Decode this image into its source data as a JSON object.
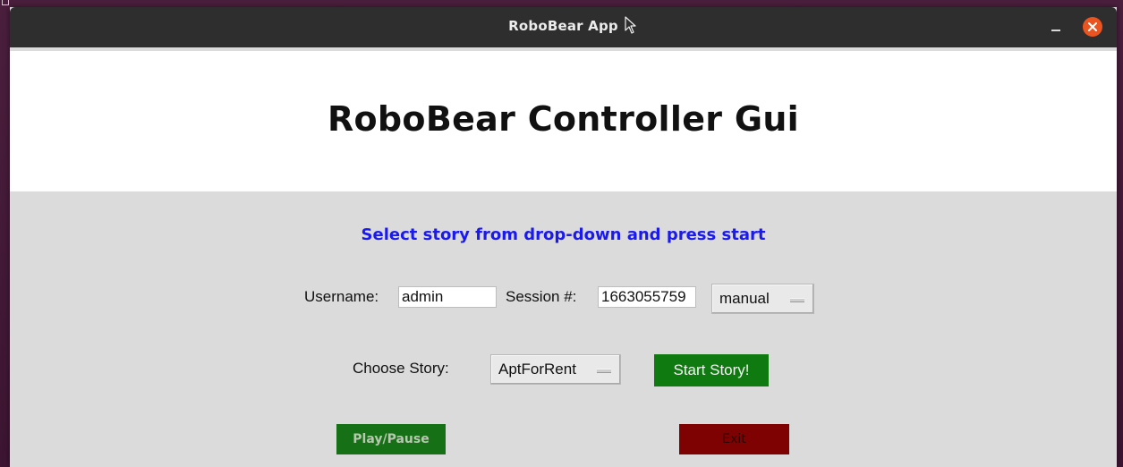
{
  "window": {
    "title": "RoboBear App",
    "close_color": "#e95420",
    "titlebar_color": "#2e2e2e"
  },
  "header": {
    "title": "RoboBear Controller Gui"
  },
  "instruction": {
    "text": "Select story from drop-down and press start",
    "color": "#1a1aee"
  },
  "form": {
    "username_label": "Username:",
    "username_value": "admin",
    "session_label": "Session #:",
    "session_value": "1663055759",
    "mode_selected": "manual",
    "story_label": "Choose Story:",
    "story_selected": "AptForRent",
    "start_label": "Start Story!"
  },
  "controls": {
    "play_pause_label": "Play/Pause",
    "exit_label": "Exit",
    "play_color": "#167016",
    "exit_color": "#7e0202"
  }
}
